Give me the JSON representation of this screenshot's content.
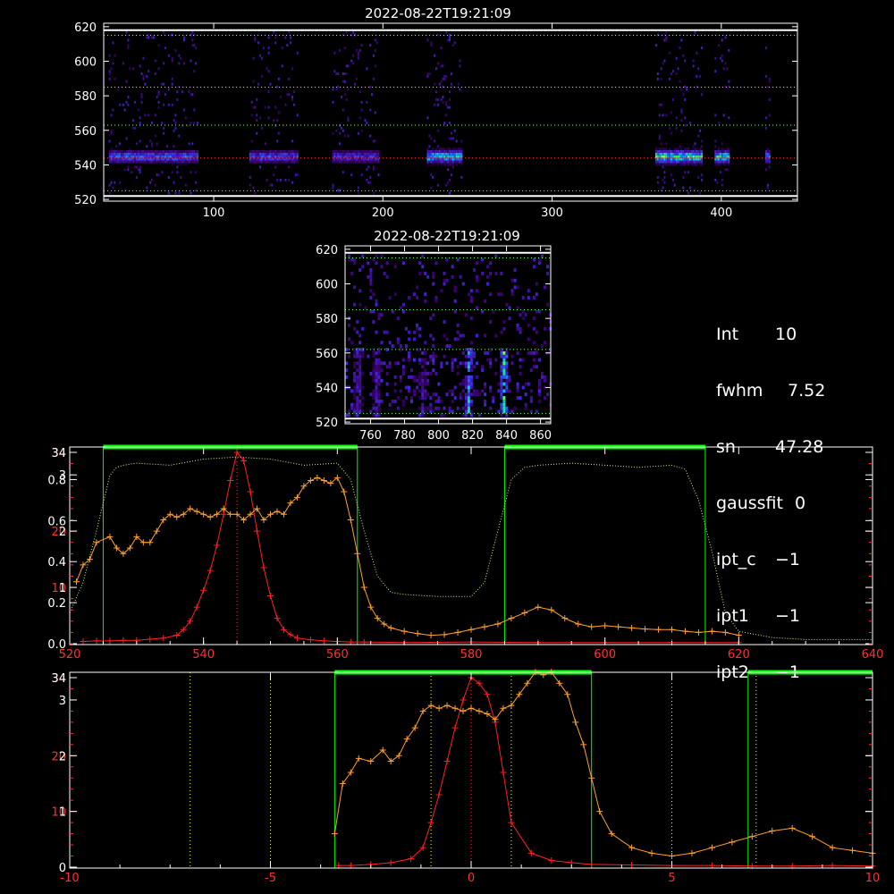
{
  "info_panel": [
    {
      "key": "Int",
      "value": "10"
    },
    {
      "key": "fwhm",
      "value": "7.52"
    },
    {
      "key": "sn",
      "value": "47.28"
    },
    {
      "key": "gaussfit",
      "value": "0"
    },
    {
      "key": "ipt_c",
      "value": "−1"
    },
    {
      "key": "ipt1",
      "value": "−1"
    },
    {
      "key": "ipt2",
      "value": "−1"
    }
  ],
  "colors": {
    "bg": "#000000",
    "axes": "#ffffff",
    "red": "#ff2020",
    "orange": "#ffa030",
    "green": "#00ff00",
    "dotted_green": "#c0ff80",
    "yellow_dotted": "#ffff60"
  },
  "chart_data": [
    {
      "id": "spectrogram_top",
      "type": "heatmap",
      "title": "2022-08-22T19:21:09",
      "xlim": [
        35,
        445
      ],
      "ylim": [
        519,
        622
      ],
      "xticks": [
        100,
        200,
        300,
        400
      ],
      "yticks": [
        520,
        540,
        560,
        580,
        600,
        620
      ],
      "colormap": "black-purple-blue-cyan-green-yellow",
      "signal_row": 544,
      "hlines": [
        {
          "y": 618,
          "style": "solid",
          "color": "#ffffff"
        },
        {
          "y": 615,
          "style": "dotted",
          "color": "#80ff80"
        },
        {
          "y": 585,
          "style": "dotted",
          "color": "#80ff80"
        },
        {
          "y": 563,
          "style": "dotted",
          "color": "#80ff80"
        },
        {
          "y": 544,
          "style": "dotted",
          "color": "#ff3030"
        },
        {
          "y": 525,
          "style": "dotted",
          "color": "#80ff80"
        },
        {
          "y": 522,
          "style": "solid",
          "color": "#ffffff"
        }
      ],
      "bands": [
        {
          "x0": 38,
          "x1": 90,
          "peak": 0.65
        },
        {
          "x0": 121,
          "x1": 149,
          "peak": 0.6
        },
        {
          "x0": 170,
          "x1": 197,
          "peak": 0.55
        },
        {
          "x0": 226,
          "x1": 246,
          "peak": 0.85
        },
        {
          "x0": 361,
          "x1": 388,
          "peak": 0.95
        },
        {
          "x0": 396,
          "x1": 404,
          "peak": 0.9
        },
        {
          "x0": 426,
          "x1": 428,
          "peak": 0.8
        }
      ]
    },
    {
      "id": "spectrogram_zoom",
      "type": "heatmap",
      "title": "2022-08-22T19:21:09",
      "xlim": [
        745,
        866
      ],
      "ylim": [
        519,
        622
      ],
      "xticks": [
        760,
        780,
        800,
        820,
        840,
        860
      ],
      "yticks": [
        520,
        540,
        560,
        580,
        600,
        620
      ],
      "colormap": "black-purple-blue-cyan-green-yellow",
      "hlines": [
        {
          "y": 618,
          "style": "solid",
          "color": "#ffffff"
        },
        {
          "y": 615,
          "style": "dotted",
          "color": "#80ff80"
        },
        {
          "y": 585,
          "style": "dotted",
          "color": "#80ff80"
        },
        {
          "y": 562,
          "style": "dotted",
          "color": "#80ff80"
        },
        {
          "y": 525,
          "style": "dotted",
          "color": "#80ff80"
        },
        {
          "y": 522,
          "style": "solid",
          "color": "#ffffff"
        }
      ],
      "stripes": [
        {
          "x": 752,
          "peak": 0.55
        },
        {
          "x": 763,
          "peak": 0.5
        },
        {
          "x": 790,
          "peak": 0.45
        },
        {
          "x": 817,
          "peak": 0.8
        },
        {
          "x": 838,
          "peak": 0.95
        }
      ]
    },
    {
      "id": "profile_wavelength",
      "type": "line",
      "xlim": [
        520,
        640
      ],
      "xticks": [
        520,
        540,
        560,
        580,
        600,
        620,
        640
      ],
      "left_axes": [
        {
          "ylim": [
            0,
            0.95
          ],
          "ticks": [
            "0.0",
            "0.2",
            "0.4",
            "0.6",
            "0.8"
          ],
          "tick_values": [
            0,
            0.2,
            0.4,
            0.6,
            0.8
          ],
          "color": "#ffffff"
        },
        {
          "ylim": [
            0,
            34
          ],
          "ticks": [
            "10",
            "20",
            "34"
          ],
          "tick_values": [
            10,
            20,
            34
          ],
          "color": "#ff3030"
        },
        {
          "ylim": [
            0,
            3.4
          ],
          "ticks": [
            "1",
            "2",
            "3",
            "34"
          ],
          "tick_values": [
            1,
            2,
            3,
            3.4
          ],
          "color": "#ffffff"
        }
      ],
      "green_windows": [
        [
          525,
          563
        ],
        [
          585,
          615
        ]
      ],
      "center_line_x": 545,
      "series": [
        {
          "color": "#ff2020",
          "style": "line+cross",
          "x": [
            522,
            524,
            526,
            528,
            530,
            532,
            534,
            536,
            537,
            538,
            539,
            540,
            541,
            542,
            543,
            544,
            545,
            546,
            547,
            548,
            549,
            550,
            551,
            552,
            553,
            554,
            556,
            558,
            560,
            562,
            564,
            570,
            580,
            590,
            600,
            610,
            620
          ],
          "y": [
            0.4,
            0.5,
            0.5,
            0.6,
            0.6,
            0.8,
            1.0,
            1.5,
            2.5,
            4.0,
            6.5,
            9.5,
            13,
            17.5,
            23,
            29,
            34,
            32.5,
            27,
            20,
            13.5,
            8.5,
            4.5,
            2.5,
            1.6,
            1.0,
            0.7,
            0.5,
            0.4,
            0.3,
            0.3,
            0.2,
            0.3,
            0.2,
            0.2,
            0.2,
            0.2
          ]
        },
        {
          "color": "#ffa030",
          "style": "line+cross",
          "x": [
            521,
            522,
            523,
            524,
            526,
            527,
            528,
            529,
            530,
            531,
            532,
            533,
            534,
            535,
            536,
            537,
            538,
            539,
            540,
            541,
            542,
            543,
            544,
            545,
            546,
            547,
            548,
            549,
            550,
            551,
            552,
            553,
            554,
            555,
            556,
            557,
            558,
            559,
            560,
            561,
            562,
            563,
            564,
            565,
            566,
            567,
            568,
            570,
            572,
            574,
            576,
            578,
            580,
            582,
            584,
            586,
            588,
            590,
            592,
            594,
            596,
            598,
            600,
            602,
            604,
            606,
            608,
            610,
            612,
            614,
            616,
            618,
            620
          ],
          "y": [
            1.1,
            1.4,
            1.5,
            1.8,
            1.9,
            1.7,
            1.6,
            1.7,
            1.9,
            1.8,
            1.8,
            2.0,
            2.2,
            2.3,
            2.25,
            2.3,
            2.4,
            2.35,
            2.3,
            2.25,
            2.3,
            2.4,
            2.3,
            2.3,
            2.2,
            2.3,
            2.4,
            2.2,
            2.3,
            2.35,
            2.3,
            2.5,
            2.6,
            2.8,
            2.9,
            2.95,
            2.9,
            2.85,
            2.95,
            2.7,
            2.2,
            1.6,
            1.0,
            0.65,
            0.45,
            0.35,
            0.28,
            0.22,
            0.18,
            0.15,
            0.16,
            0.2,
            0.25,
            0.3,
            0.35,
            0.45,
            0.55,
            0.65,
            0.6,
            0.45,
            0.35,
            0.3,
            0.32,
            0.3,
            0.28,
            0.26,
            0.25,
            0.25,
            0.22,
            0.2,
            0.22,
            0.2,
            0.15
          ]
        },
        {
          "color": "#c0ff80",
          "style": "dotted",
          "axis": 0,
          "x": [
            520,
            522,
            524,
            526,
            527,
            528,
            530,
            535,
            540,
            545,
            550,
            555,
            560,
            562,
            564,
            566,
            568,
            570,
            575,
            580,
            582,
            584,
            586,
            588,
            590,
            595,
            600,
            605,
            610,
            612,
            614,
            616,
            618,
            620,
            625,
            630,
            640
          ],
          "y": [
            0.15,
            0.3,
            0.55,
            0.82,
            0.86,
            0.87,
            0.88,
            0.87,
            0.9,
            0.91,
            0.9,
            0.87,
            0.88,
            0.8,
            0.55,
            0.33,
            0.25,
            0.24,
            0.23,
            0.23,
            0.3,
            0.55,
            0.8,
            0.86,
            0.87,
            0.88,
            0.87,
            0.86,
            0.87,
            0.85,
            0.7,
            0.45,
            0.15,
            0.06,
            0.03,
            0.02,
            0.02
          ]
        }
      ]
    },
    {
      "id": "profile_velocity",
      "type": "line",
      "xlim": [
        -10,
        10
      ],
      "xticks": [
        -10,
        -5,
        0,
        5,
        10
      ],
      "left_axes": [
        {
          "ylim": [
            0,
            34
          ],
          "ticks": [
            "10",
            "20",
            "34"
          ],
          "tick_values": [
            10,
            20,
            34
          ],
          "color": "#ff3030"
        },
        {
          "ylim": [
            0,
            3.4
          ],
          "ticks": [
            "0",
            "1",
            "2",
            "3",
            "34"
          ],
          "tick_values": [
            0,
            1,
            2,
            3,
            3.4
          ],
          "color": "#ffffff"
        }
      ],
      "green_windows": [
        [
          -3.4,
          3.0
        ],
        [
          6.9,
          10
        ]
      ],
      "vertical_dotted": [
        -7,
        -5,
        -1,
        1,
        5,
        7.1
      ],
      "center_line_x": 0,
      "series": [
        {
          "color": "#ff2020",
          "style": "line+cross",
          "x": [
            -3.3,
            -3,
            -2.5,
            -2,
            -1.5,
            -1.2,
            -1,
            -0.8,
            -0.6,
            -0.4,
            -0.2,
            0,
            0.2,
            0.4,
            0.6,
            0.8,
            1,
            1.5,
            2,
            2.5,
            3,
            4,
            5,
            6,
            7,
            8,
            9,
            10
          ],
          "y": [
            0.3,
            0.3,
            0.5,
            0.8,
            1.5,
            3.5,
            8,
            13,
            19,
            25,
            30,
            34,
            33,
            31,
            26,
            17,
            8,
            2.5,
            1.2,
            0.8,
            0.5,
            0.4,
            0.3,
            0.3,
            0.2,
            0.2,
            0.3,
            0.2
          ]
        },
        {
          "color": "#ffa030",
          "style": "line+cross",
          "x": [
            -3.4,
            -3.2,
            -3,
            -2.8,
            -2.5,
            -2.2,
            -2,
            -1.8,
            -1.6,
            -1.4,
            -1.2,
            -1,
            -0.8,
            -0.6,
            -0.4,
            -0.2,
            0,
            0.2,
            0.4,
            0.6,
            0.8,
            1,
            1.2,
            1.4,
            1.6,
            1.8,
            2,
            2.2,
            2.4,
            2.6,
            2.8,
            3,
            3.2,
            3.5,
            4,
            4.5,
            5,
            5.5,
            6,
            6.5,
            7,
            7.5,
            8,
            8.5,
            9,
            9.5,
            10
          ],
          "y": [
            0.6,
            1.5,
            1.7,
            1.95,
            1.9,
            2.1,
            1.9,
            2.0,
            2.3,
            2.5,
            2.8,
            2.9,
            2.85,
            2.9,
            2.85,
            2.8,
            2.85,
            2.8,
            2.75,
            2.65,
            2.85,
            2.9,
            3.1,
            3.3,
            3.5,
            3.45,
            3.5,
            3.3,
            3.1,
            2.6,
            2.2,
            1.6,
            1.0,
            0.6,
            0.35,
            0.25,
            0.2,
            0.25,
            0.35,
            0.45,
            0.55,
            0.65,
            0.7,
            0.55,
            0.35,
            0.3,
            0.25
          ]
        }
      ]
    }
  ]
}
